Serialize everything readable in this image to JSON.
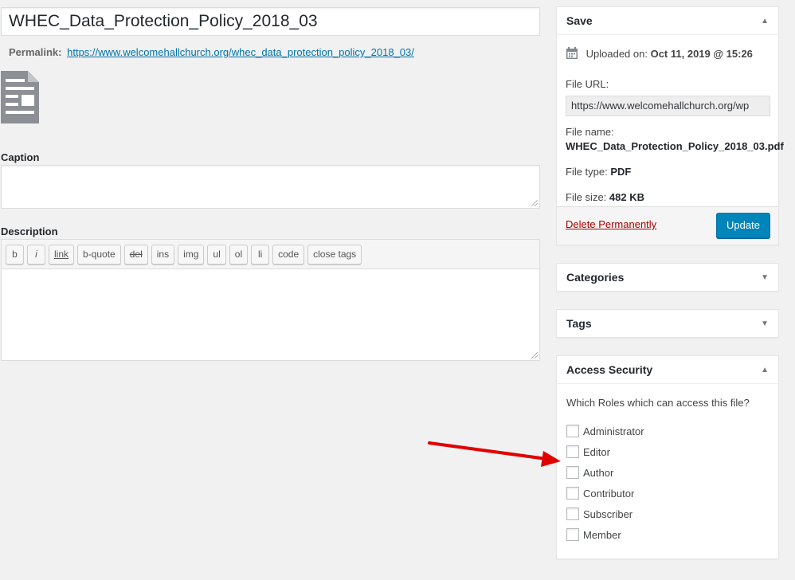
{
  "title": "WHEC_Data_Protection_Policy_2018_03",
  "permalink": {
    "label": "Permalink:",
    "url": "https://www.welcomehallchurch.org/whec_data_protection_policy_2018_03/"
  },
  "caption": {
    "label": "Caption",
    "value": ""
  },
  "description": {
    "label": "Description",
    "value": "",
    "toolbar": [
      "b",
      "i",
      "link",
      "b-quote",
      "del",
      "ins",
      "img",
      "ul",
      "ol",
      "li",
      "code",
      "close tags"
    ]
  },
  "save_box": {
    "title": "Save",
    "uploaded_label": "Uploaded on:",
    "uploaded_value": "Oct 11, 2019 @ 15:26",
    "file_url_label": "File URL:",
    "file_url_value": "https://www.welcomehallchurch.org/wp",
    "file_name_label": "File name:",
    "file_name_value": "WHEC_Data_Protection_Policy_2018_03.pdf",
    "file_type_label": "File type:",
    "file_type_value": "PDF",
    "file_size_label": "File size:",
    "file_size_value": "482 KB",
    "delete_label": "Delete Permanently",
    "update_label": "Update"
  },
  "categories_box": {
    "title": "Categories"
  },
  "tags_box": {
    "title": "Tags"
  },
  "access_security": {
    "title": "Access Security",
    "question": "Which Roles which can access this file?",
    "roles": [
      "Administrator",
      "Editor",
      "Author",
      "Contributor",
      "Subscriber",
      "Member"
    ]
  },
  "colors": {
    "primary_button": "#0085ba",
    "link": "#0073aa",
    "delete": "#a00",
    "annotation_arrow": "#e00000"
  },
  "icons": {
    "document": "document-icon",
    "calendar": "calendar-icon",
    "toggle_up": "toggle-up-icon",
    "toggle_down": "toggle-down-icon"
  }
}
